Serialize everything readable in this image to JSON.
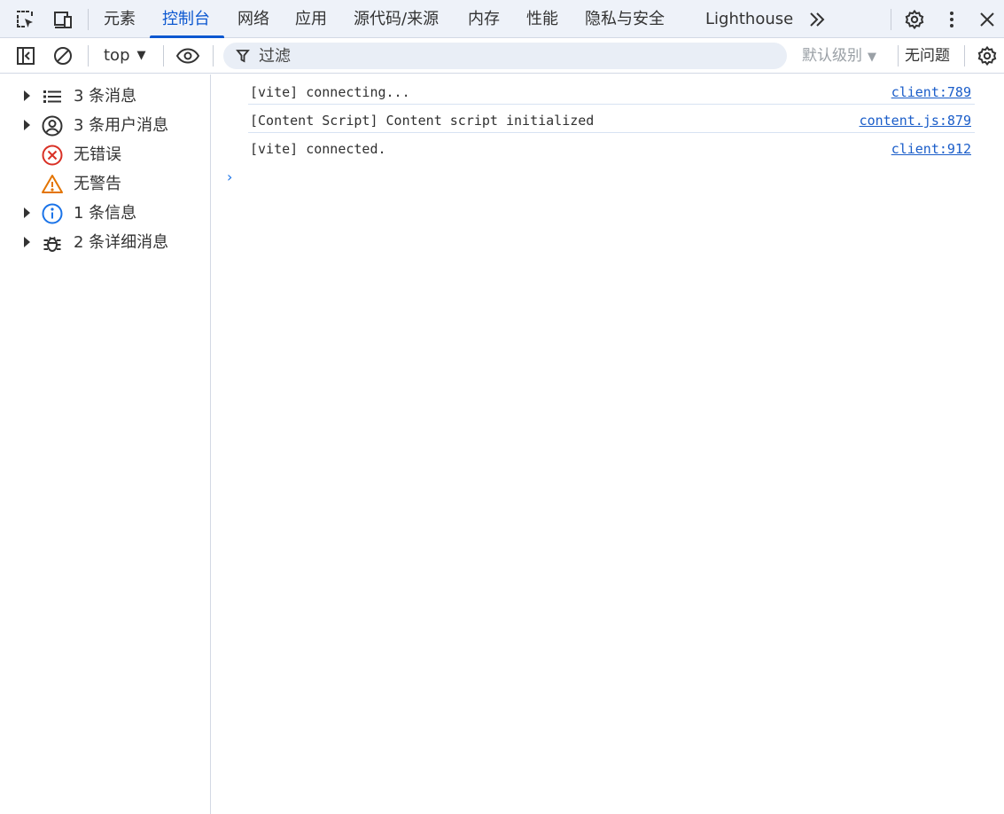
{
  "tabbar": {
    "icons": [
      "inspect-element-icon",
      "device-toolbar-icon",
      "settings-icon",
      "more-vert-icon",
      "close-icon",
      "chevron-double-right-icon"
    ],
    "tabs": [
      {
        "label": "元素",
        "active": false
      },
      {
        "label": "控制台",
        "active": true
      },
      {
        "label": "网络",
        "active": false
      },
      {
        "label": "应用",
        "active": false
      },
      {
        "label": "源代码/来源",
        "active": false
      },
      {
        "label": "内存",
        "active": false
      },
      {
        "label": "性能",
        "active": false
      },
      {
        "label": "隐私与安全",
        "active": false
      },
      {
        "label": "Lighthouse",
        "active": false
      }
    ]
  },
  "toolbar": {
    "context": "top",
    "filter_placeholder": "过滤",
    "levels": "默认级别",
    "issues": "无问题",
    "icons": [
      "sidebar-toggle-icon",
      "clear-console-icon",
      "eye-icon",
      "filter-icon",
      "settings-icon"
    ]
  },
  "sidebar": {
    "items": [
      {
        "label": "3 条消息",
        "icon": "list-icon",
        "expandable": true
      },
      {
        "label": "3 条用户消息",
        "icon": "user-circle-icon",
        "expandable": true
      },
      {
        "label": "无错误",
        "icon": "error-circle-icon",
        "expandable": false
      },
      {
        "label": "无警告",
        "icon": "warning-triangle-icon",
        "expandable": false
      },
      {
        "label": "1 条信息",
        "icon": "info-icon",
        "expandable": true
      },
      {
        "label": "2 条详细消息",
        "icon": "bug-icon",
        "expandable": true
      }
    ]
  },
  "console": {
    "messages": [
      {
        "text": "[vite] connecting...",
        "source": "client:789"
      },
      {
        "text": "[Content Script] Content script initialized",
        "source": "content.js:879"
      },
      {
        "text": "[vite] connected.",
        "source": "client:912"
      }
    ],
    "prompt": "›"
  },
  "colors": {
    "accent": "#0b57d0",
    "link": "#1a5dc9",
    "error": "#d93025",
    "warning": "#e37400",
    "info": "#1a73e8"
  }
}
